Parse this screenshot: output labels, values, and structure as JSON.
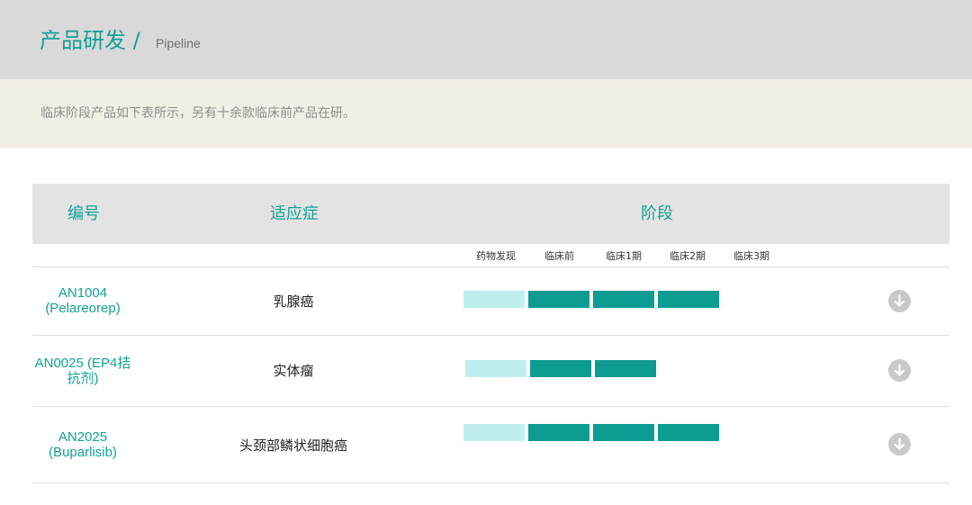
{
  "header": {
    "title": "产品研发 /",
    "subtitle": "Pipeline"
  },
  "intro": {
    "text": "临床阶段产品如下表所示，另有十余款临床前产品在研。"
  },
  "table": {
    "columns": {
      "code": "编号",
      "indication": "适应症",
      "stage": "阶段"
    },
    "phases": [
      "药物发现",
      "临床前",
      "临床1期",
      "临床2期",
      "临床3期"
    ],
    "rows": [
      {
        "code_line1": "AN1004",
        "code_line2": "(Pelareorep)",
        "indication": "乳腺癌",
        "stages_completed": 4
      },
      {
        "code_line1": "AN0025 (EP4拮",
        "code_line2": "抗剂)",
        "indication": "实体瘤",
        "stages_completed": 3
      },
      {
        "code_line1": "AN2025",
        "code_line2": "(Buparlisib)",
        "indication": "头颈部鳞状细胞癌",
        "stages_completed": 4
      }
    ]
  },
  "colors": {
    "accent": "#13a096",
    "bar_light": "#bfeeee",
    "bar_dark": "#0e9b91",
    "download_button": "#c9c9c9"
  },
  "icons": {
    "row_action": "download-arrow-icon"
  }
}
